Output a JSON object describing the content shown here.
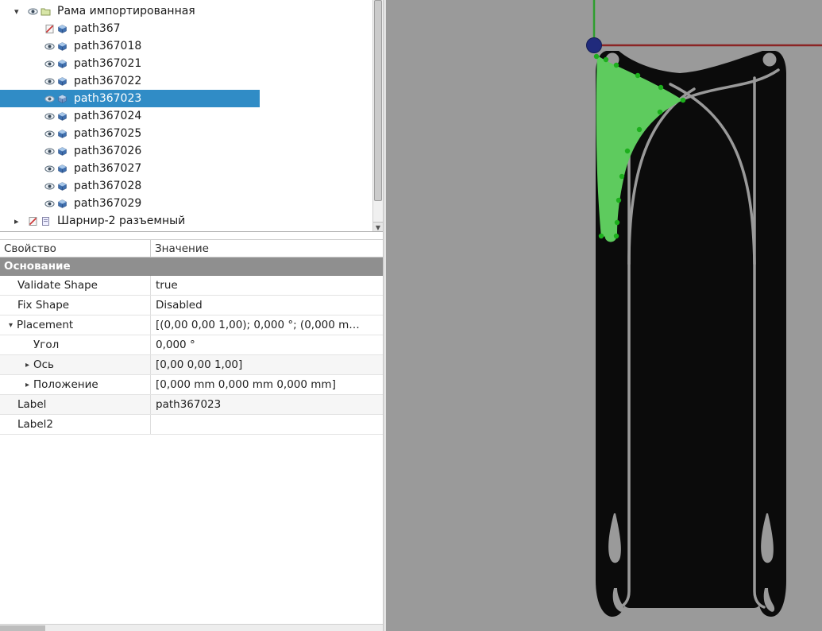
{
  "tree": {
    "root_label": "Рама импортированная",
    "items": [
      {
        "label": "path367"
      },
      {
        "label": "path367018"
      },
      {
        "label": "path367021"
      },
      {
        "label": "path367022"
      },
      {
        "label": "path367023"
      },
      {
        "label": "path367024"
      },
      {
        "label": "path367025"
      },
      {
        "label": "path367026"
      },
      {
        "label": "path367027"
      },
      {
        "label": "path367028"
      },
      {
        "label": "path367029"
      }
    ],
    "selected_index": 4,
    "selected_label": "path367023",
    "selection_color": "#308cc6",
    "footer_label": "Шарнир-2 разъемный"
  },
  "icons": {
    "expander_open": "▾",
    "expander_closed": "▸",
    "scroll_down_arrow": "▼"
  },
  "properties": {
    "header_property": "Свойство",
    "header_value": "Значение",
    "group_label": "Основание",
    "rows": [
      {
        "name": "Validate Shape",
        "value": "true"
      },
      {
        "name": "Fix Shape",
        "value": "Disabled"
      },
      {
        "name": "Placement",
        "value": "[(0,00 0,00 1,00); 0,000 °; (0,000 m…"
      },
      {
        "name": "Угол",
        "value": "0,000 °"
      },
      {
        "name": "Ось",
        "value": "[0,00 0,00 1,00]"
      },
      {
        "name": "Положение",
        "value": "[0,000 mm  0,000 mm  0,000 mm]"
      },
      {
        "name": "Label",
        "value": "path367023"
      },
      {
        "name": "Label2",
        "value": ""
      }
    ]
  },
  "viewport": {
    "background": "#9a9a9a",
    "shape_color": "#0b0b0b",
    "highlight_color": "#5ecb5e",
    "point_color": "#1daf1d",
    "axis_x_color": "#8b2424",
    "axis_y_color": "#2f9e2f",
    "origin_color": "#202a7c"
  }
}
